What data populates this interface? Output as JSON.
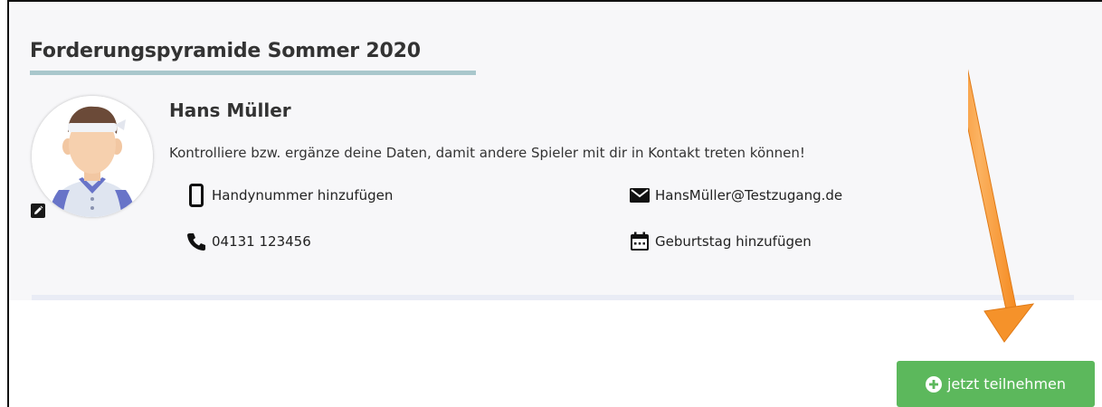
{
  "card": {
    "title": "Forderungspyramide Sommer 2020"
  },
  "profile": {
    "name": "Hans Müller",
    "notice": "Kontrolliere bzw. ergänze deine Daten, damit andere Spieler mit dir in Kontakt treten können!"
  },
  "contacts": {
    "mobile": "Handynummer hinzufügen",
    "phone": "04131 123456",
    "email": "HansMüller@Testzugang.de",
    "birthday": "Geburtstag hinzufügen"
  },
  "actions": {
    "join_label": "jetzt teilnehmen"
  },
  "colors": {
    "accent_green": "#5cb85c",
    "title_underline": "#a9c7cc",
    "annotation_arrow": "#f7932e"
  },
  "icons": {
    "mobile": "smartphone-icon",
    "phone": "phone-icon",
    "email": "envelope-icon",
    "birthday": "calendar-icon",
    "edit": "pencil-icon",
    "join": "plus-circle-icon"
  }
}
